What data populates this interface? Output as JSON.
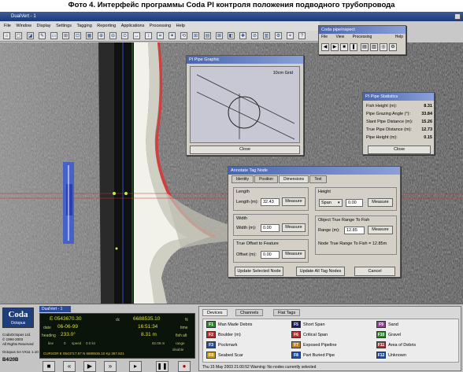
{
  "caption": "Фото 4. Интерфейс программы Coda PI контроля положения подводного трубопровода",
  "window": {
    "title": "DualVert - 1"
  },
  "menu": [
    "File",
    "Window",
    "Display",
    "Settings",
    "Tagging",
    "Reporting",
    "Applications",
    "Processing",
    "Help"
  ],
  "toolbar_glyphs": [
    "⌂",
    "▢",
    "◪",
    "✎",
    "▭",
    "⊞",
    "⊡",
    "▦",
    "⊕",
    "⊖",
    "⊙",
    "↔",
    "↕",
    "⌗",
    "✦",
    "⟲",
    "⊞",
    "▤",
    "⊠",
    "◧",
    "✚",
    "⊘",
    "▥",
    "⚙",
    "⌖",
    "?"
  ],
  "pipe_inspect": {
    "title": "Coda pipeInspect",
    "menu": [
      "File",
      "View",
      "Processing",
      "Help"
    ]
  },
  "pipe_graphic": {
    "title": "PI Pipe Graphic",
    "grid": "10cm Grid",
    "close": "Close"
  },
  "pipe_stats": {
    "title": "PI Pipe Statistics",
    "rows": [
      {
        "label": "Fish Height (m):",
        "value": "8.31"
      },
      {
        "label": "Pipe Grazing Angle (°):",
        "value": "33.84"
      },
      {
        "label": "Slant Pipe Distance (m):",
        "value": "15.26"
      },
      {
        "label": "True Pipe Distance (m):",
        "value": "12.73"
      },
      {
        "label": "Pipe Height (m):",
        "value": "0.15"
      }
    ],
    "close": "Close"
  },
  "annotate": {
    "title": "Annotate Tag Node",
    "tabs": [
      "Identity",
      "Position",
      "Dimensions",
      "Text"
    ],
    "length_group": "Length",
    "length_label": "Length (m):",
    "length_value": "32.43",
    "width_group": "Width",
    "width_label": "Width (m):",
    "width_value": "0.00",
    "offset_group": "True Offset to Feature",
    "offset_label": "Offset (m):",
    "offset_value": "0.00",
    "height_group": "Height",
    "height_mode": "Span",
    "height_value": "0.00",
    "range_group": "Object True Range To Fish",
    "range_label": "Range (m):",
    "range_value": "12.85",
    "node_range": "Node True Range To Fish = 12.85m",
    "measure": "Measure",
    "update_selected": "Update Selected Node",
    "update_all": "Update All Tag Nodes",
    "cancel": "Cancel"
  },
  "bottom": {
    "logo": "Coda",
    "logo_sub": "Octopus",
    "tab": "DualVert - 1",
    "copyright": [
      "CodaOctopus Ltd.",
      "© 1994-2003",
      "All Rights Reserved"
    ],
    "version": "Octopus SA VX11 1.10",
    "dev_code": "B4/20B"
  },
  "nav": {
    "e_left": "E 0543670.30",
    "n_left": "6688535.10",
    "e_left_unit": "dc",
    "n_left_unit": "N",
    "date_label": "date",
    "date": "06-06-99",
    "time": "16:51:34",
    "time_label": "time",
    "heading_label": "heading",
    "heading": "233.0°",
    "fish_alt": "8.31 m",
    "fish_alt_label": "fish alt",
    "line_label": "line",
    "line_value": "0",
    "range": "82.09 m",
    "range_label": "range",
    "speed_label": "speed",
    "speed": "0.0 kn",
    "disable_label": "disable",
    "cursor": "CURSOR  E 0543717.97  N 6688536.10  Kp 357.621"
  },
  "tag_panel": {
    "tabs": [
      "Devices",
      "Channels",
      "Flat Tags"
    ],
    "tags": [
      {
        "key": "F1",
        "name": "Man Made Debris",
        "color": "#2a8a2a"
      },
      {
        "key": "F5",
        "name": "Short Span",
        "color": "#1a1a6a"
      },
      {
        "key": "F9",
        "name": "Sand",
        "color": "#9a3a9a"
      },
      {
        "key": "F2",
        "name": "Boulder (m)",
        "color": "#b03030"
      },
      {
        "key": "F6",
        "name": "Critical Span",
        "color": "#b03030"
      },
      {
        "key": "F10",
        "name": "Gravel",
        "color": "#2a8a2a"
      },
      {
        "key": "F3",
        "name": "Pockmark",
        "color": "#2050a0"
      },
      {
        "key": "F7",
        "name": "Exposed Pipeline",
        "color": "#c08020"
      },
      {
        "key": "F11",
        "name": "Area of Debris",
        "color": "#b03030"
      },
      {
        "key": "F4",
        "name": "Seabed Scar",
        "color": "#c0a020"
      },
      {
        "key": "F8",
        "name": "Part Buried Pipe",
        "color": "#2050a0"
      },
      {
        "key": "F12",
        "name": "Unknown",
        "color": "#2050a0"
      }
    ],
    "status": "Thu 15 May 2003 21:00:52 Warning: No nodes currently selected"
  }
}
